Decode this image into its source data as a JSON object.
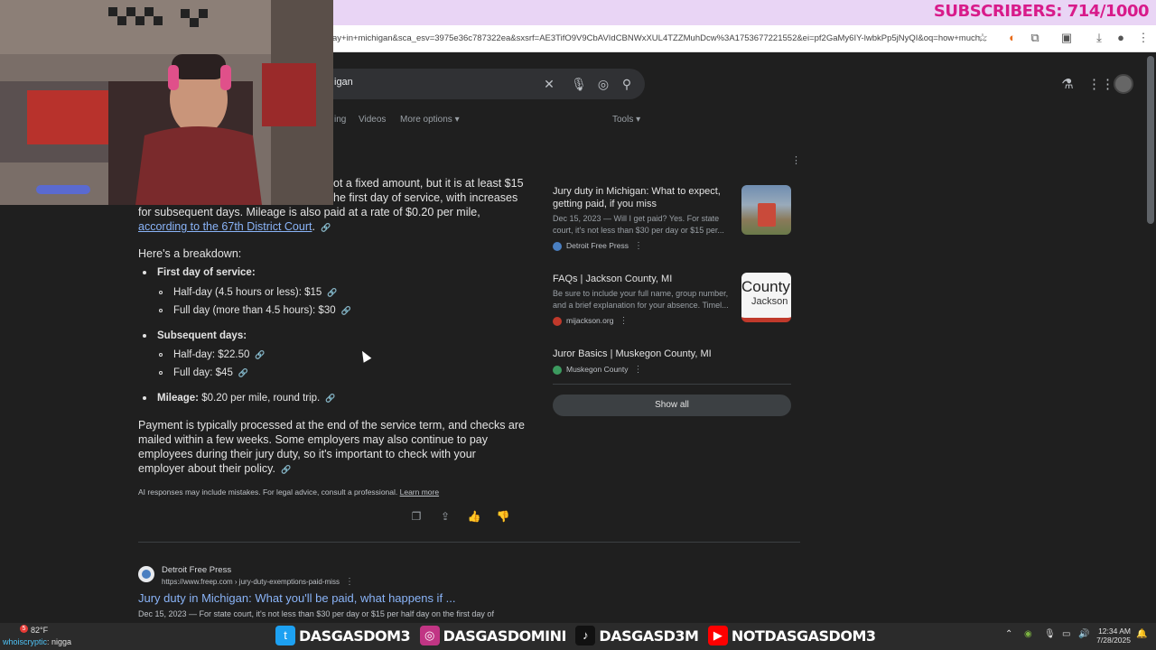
{
  "stream": {
    "subscriber_counter": "SUBSCRIBERS: 714/1000",
    "socials": [
      {
        "icon": "twitter-icon",
        "handle": "DASGASDOM3",
        "color": "#1da1f2"
      },
      {
        "icon": "instagram-icon",
        "handle": "DASGASDOMINI",
        "color": "#c13584"
      },
      {
        "icon": "tiktok-icon",
        "handle": "DASGASD3M",
        "color": "#111111"
      },
      {
        "icon": "youtube-icon",
        "handle": "NOTDASGASDOM3",
        "color": "#ff0000"
      }
    ]
  },
  "browser": {
    "url": "ay+in+michigan&sca_esv=3975e36c787322ea&sxsrf=AE3TifO9V9CbAVIdCBNWxXUL4TZZMuhDcw%3A1753677221552&ei=pf2GaMy6IY-lwbkPp5jNyQI&oq=how+much..."
  },
  "search": {
    "query_visible": "igan",
    "tabs": [
      "ing",
      "Videos",
      "More options",
      "Tools"
    ]
  },
  "ai_overview": {
    "intro_line1": "ot a fixed amount, but it is at least $15",
    "intro_line2": "he first day of service, with increases",
    "intro_line3": "for subsequent days. Mileage is also paid at a rate of $0.20 per mile,",
    "intro_link": "according to the 67th District Court",
    "intro_end": ".",
    "breakdown_heading": "Here's a breakdown:",
    "first_day_label": "First day of service:",
    "first_day_items": [
      "Half-day (4.5 hours or less): $15",
      "Full day (more than 4.5 hours): $30"
    ],
    "subsequent_label": "Subsequent days:",
    "subsequent_items": [
      "Half-day: $22.50",
      "Full day: $45"
    ],
    "mileage_label": "Mileage:",
    "mileage_value": " $0.20 per mile, round trip.",
    "payment_line1": "Payment is typically processed at the end of the service term, and checks are",
    "payment_line2": "mailed within a few weeks. Some employers may also continue to pay",
    "payment_line3": "employees during their jury duty, so it's important to check with your",
    "payment_line4": "employer about their policy.",
    "disclaimer": "AI responses may include mistakes. For legal advice, consult a professional.",
    "learn_more": "Learn more"
  },
  "sources": [
    {
      "title": "Jury duty in Michigan: What to expect, getting paid, if you miss",
      "snippet": "Dec 15, 2023 — Will I get paid? Yes. For state court, it's not less than $30 per day or $15 per...",
      "site": "Detroit Free Press",
      "favicon_color": "#4a7fc1"
    },
    {
      "title": "FAQs | Jackson County, MI",
      "snippet": "Be sure to include your full name, group number, and a brief explanation for your absence. Timel...",
      "site": "mijackson.org",
      "favicon_color": "#c0392b",
      "thumb_text1": "County",
      "thumb_text2": "Jackson"
    },
    {
      "title": "Juror Basics | Muskegon County, MI",
      "site": "Muskegon County",
      "favicon_color": "#3c9a5f"
    }
  ],
  "show_all": "Show all",
  "result": {
    "site": "Detroit Free Press",
    "url": "https://www.freep.com › jury-duty-exemptions-paid-miss",
    "title": "Jury duty in Michigan: What you'll be paid, what happens if ...",
    "snippet": "Dec 15, 2023 — For state court, it's not less than $30 per day or $15 per half day on the first day of"
  },
  "taskbar": {
    "weather": "82°F",
    "notification_badge": "5",
    "chat_user": "whoiscryptic",
    "chat_message": "nigga",
    "time": "12:34 AM",
    "date": "7/28/2025"
  }
}
